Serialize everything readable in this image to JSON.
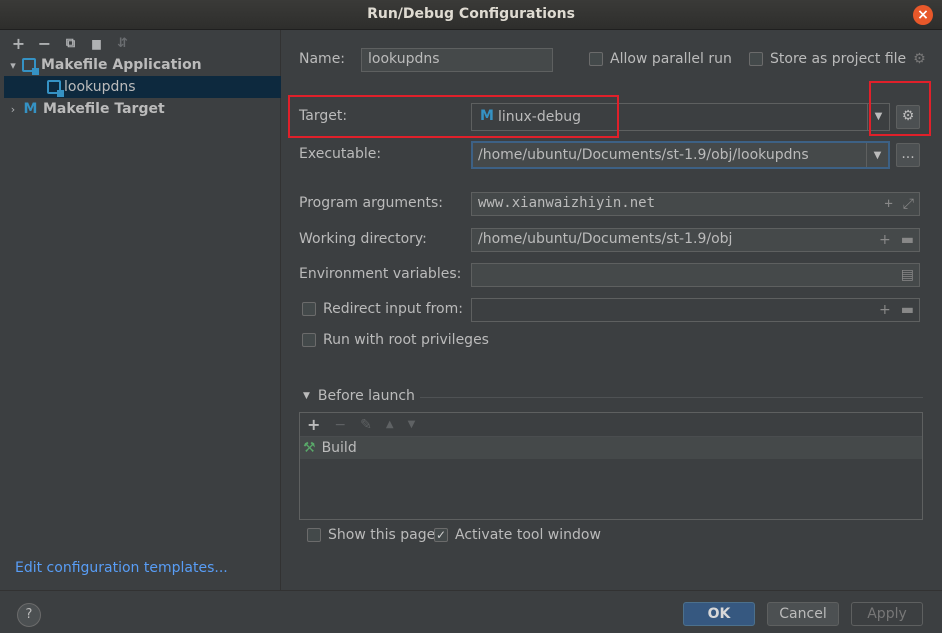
{
  "window": {
    "title": "Run/Debug Configurations",
    "close_icon": "×"
  },
  "left": {
    "toolbar": [
      {
        "name": "add-icon",
        "glyph": "+"
      },
      {
        "name": "remove-icon",
        "glyph": "−"
      },
      {
        "name": "copy-icon",
        "glyph": "⧉"
      },
      {
        "name": "folder-icon",
        "glyph": "▆"
      },
      {
        "name": "sort-icon",
        "glyph": "⇵"
      }
    ],
    "tree": {
      "group1": "Makefile Application",
      "child1": "lookupdns",
      "group2": "Makefile Target",
      "chev_open": "▾",
      "chev_closed": "›",
      "m_glyph": "M"
    },
    "edit_templates": "Edit configuration templates..."
  },
  "form": {
    "name_label": "Name:",
    "name_value": "lookupdns",
    "allow_parallel": "Allow parallel run",
    "store_project": "Store as project file",
    "target_label": "Target:",
    "target_value": "linux-debug",
    "executable_label": "Executable:",
    "executable_value": "/home/ubuntu/Documents/st-1.9/obj/lookupdns",
    "program_args_label": "Program arguments:",
    "program_args_value": "www.xianwaizhiyin.net",
    "working_dir_label": "Working directory:",
    "working_dir_value": "/home/ubuntu/Documents/st-1.9/obj",
    "env_label": "Environment variables:",
    "env_value": "",
    "redirect_label": "Redirect input from:",
    "redirect_value": "",
    "root_priv_label": "Run with root privileges",
    "dots_label": "...",
    "gear_glyph": "⚙",
    "dropdown_glyph": "▼",
    "plus_glyph": "+",
    "expand_glyph": "⤢",
    "folder_glyph": "▬",
    "doc_glyph": "▤"
  },
  "before_launch": {
    "title": "Before launch",
    "toolbar": [
      "+",
      "−",
      "✎",
      "▲",
      "▼"
    ],
    "items": [
      "Build"
    ],
    "show_page": "Show this page",
    "activate_tool": "Activate tool window",
    "check_glyph": "✓"
  },
  "buttons": {
    "help": "?",
    "ok": "OK",
    "cancel": "Cancel",
    "apply": "Apply"
  }
}
